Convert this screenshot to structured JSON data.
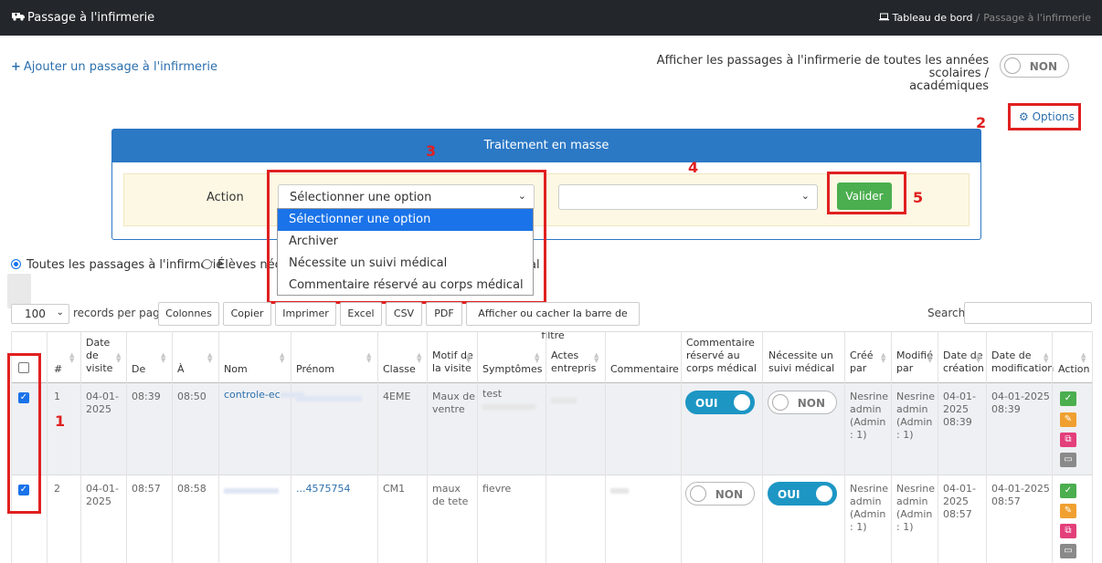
{
  "topbar": {
    "title": "Passage à l'infirmerie",
    "breadcrumb_home": "Tableau de bord",
    "breadcrumb_sep": "/",
    "breadcrumb_current": "Passage à l'infirmerie"
  },
  "add_link": "Ajouter un passage à l'infirmerie",
  "show_all": {
    "label_line1": "Afficher les passages à l'infirmerie de toutes les années scolaires /",
    "label_line2": "académiques",
    "toggle": "NON"
  },
  "options_link": "Options",
  "annotations": [
    "1",
    "2",
    "3",
    "4",
    "5"
  ],
  "mass": {
    "title": "Traitement en masse",
    "action_label": "Action",
    "select_value": "Sélectionner une option",
    "valider": "Valider",
    "options": [
      "Sélectionner une option",
      "Archiver",
      "Nécessite un suivi médical",
      "Commentaire réservé au corps médical"
    ]
  },
  "filters": {
    "radio1": "Toutes les passages à l'infirmerie",
    "radio2": "Élèves néc",
    "radio3_tail": "al"
  },
  "datatable": {
    "length": "100",
    "records_label": "records per page",
    "buttons": [
      "Colonnes",
      "Copier",
      "Imprimer",
      "Excel",
      "CSV",
      "PDF",
      "Afficher ou cacher la barre de filtre"
    ],
    "search_label": "Search:"
  },
  "columns": {
    "num": "#",
    "date_visite": [
      "Date",
      "de",
      "visite"
    ],
    "de": "De",
    "a": "À",
    "nom": "Nom",
    "prenom": "Prénom",
    "classe": "Classe",
    "motif": [
      "Motif de",
      "la visite"
    ],
    "symptomes": "Symptômes",
    "actes": [
      "Actes",
      "entrepris"
    ],
    "commentaire": "Commentaire",
    "comm_reserve": [
      "Commentaire",
      "réservé au",
      "corps médical"
    ],
    "suivi": [
      "Nécessite un",
      "suivi médical"
    ],
    "cree_par": [
      "Créé",
      "par"
    ],
    "modifie_par": [
      "Modifié",
      "par"
    ],
    "date_creation": [
      "Date de",
      "création"
    ],
    "date_modif": [
      "Date de",
      "modification"
    ],
    "action": "Action"
  },
  "rows": [
    {
      "num": "1",
      "date": [
        "04-01-",
        "2025"
      ],
      "de": "08:39",
      "a": "08:50",
      "nom": "controle-ec",
      "classe": "4EME",
      "motif": [
        "Maux de",
        "ventre"
      ],
      "symptomes": "test",
      "comm_reserve": "OUI",
      "suivi": "NON",
      "cree_par": [
        "Nesrine",
        "admin",
        "(Admin",
        ": 1)"
      ],
      "modifie_par": [
        "Nesrine",
        "admin",
        "(Admin",
        ": 1)"
      ],
      "date_creation": [
        "04-01-",
        "2025",
        "08:39"
      ],
      "date_modif": [
        "04-01-2025",
        "08:39"
      ]
    },
    {
      "num": "2",
      "date": [
        "04-01-",
        "2025"
      ],
      "de": "08:57",
      "a": "08:58",
      "prenom": "...4575754",
      "classe": "CM1",
      "motif": [
        "maux",
        "de tete"
      ],
      "symptomes": "fievre",
      "comm_reserve": "NON",
      "suivi": "OUI",
      "cree_par": [
        "Nesrine",
        "admin",
        "(Admin",
        ": 1)"
      ],
      "modifie_par": [
        "Nesrine",
        "admin",
        "(Admin",
        ": 1)"
      ],
      "date_creation": [
        "04-01-",
        "2025",
        "08:57"
      ],
      "date_modif": [
        "04-01-2025",
        "08:57"
      ]
    }
  ]
}
